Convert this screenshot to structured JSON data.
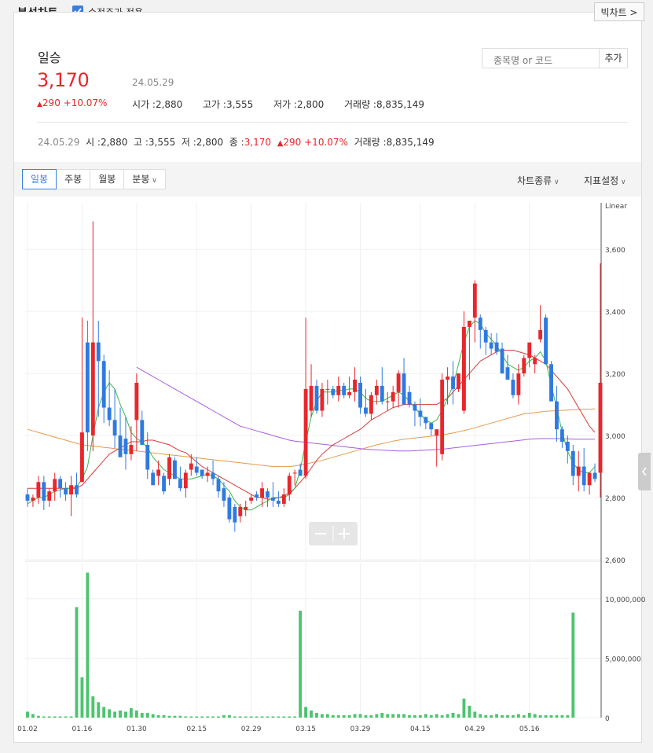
{
  "header": {
    "title": "분석차트",
    "adjusted_label": "수정주가 적용",
    "adjusted_checked": true,
    "big_chart_label": "빅차트 >"
  },
  "stock": {
    "name": "일승",
    "price": "3,170",
    "date": "24.05.29",
    "change": "290 +10.07%",
    "open_label": "시가 :",
    "open": "2,880",
    "high_label": "고가 :",
    "high": "3,555",
    "low_label": "저가 :",
    "low": "2,800",
    "volume_label": "거래량 :",
    "volume": "8,835,149"
  },
  "search": {
    "placeholder": "종목명 or 코드",
    "add_label": "추가"
  },
  "dayinfo": {
    "date": "24.05.29",
    "open_label": "시 :",
    "open": "2,880",
    "high_label": "고 :",
    "high": "3,555",
    "low_label": "저 :",
    "low": "2,800",
    "close_label": "종 :",
    "close": "3,170",
    "change": "290 +10.07%",
    "volume_label": "거래량 :",
    "volume": "8,835,149"
  },
  "toolbar": {
    "periods": [
      "일봉",
      "주봉",
      "월봉",
      "분봉"
    ],
    "active_period": "일봉",
    "chart_type_label": "차트종류",
    "indicator_label": "지표설정"
  },
  "colors": {
    "up": "#e8262c",
    "down": "#2f7ae0",
    "volume": "#4cc46e",
    "ma5": "#3bb84a",
    "ma20": "#d83a3a",
    "ma60": "#a85ee0",
    "ma120": "#e59a4a"
  },
  "chart_data": {
    "type": "candlestick",
    "scale": "Linear",
    "price_ylim": [
      2600,
      3750
    ],
    "price_ticks": [
      "3,600",
      "3,400",
      "3,200",
      "3,000",
      "2,800",
      "2,600"
    ],
    "volume_ticks": [
      "10,000,000",
      "5,000,000",
      "0"
    ],
    "volume_ylim": [
      0,
      12500000
    ],
    "x_tick_labels": [
      "01.02",
      "01.16",
      "01.30",
      "02.15",
      "02.29",
      "03.15",
      "03.29",
      "04.15",
      "04.29",
      "05.16"
    ],
    "x_tick_index": [
      0,
      10,
      20,
      31,
      41,
      51,
      61,
      72,
      82,
      92
    ],
    "ohlc": [
      [
        2810,
        2830,
        2770,
        2790
      ],
      [
        2790,
        2810,
        2770,
        2800
      ],
      [
        2800,
        2870,
        2780,
        2850
      ],
      [
        2850,
        2870,
        2760,
        2790
      ],
      [
        2790,
        2830,
        2770,
        2820
      ],
      [
        2820,
        2880,
        2790,
        2860
      ],
      [
        2860,
        2870,
        2800,
        2830
      ],
      [
        2830,
        2850,
        2790,
        2810
      ],
      [
        2810,
        2870,
        2740,
        2840
      ],
      [
        2840,
        2880,
        2800,
        2810
      ],
      [
        2850,
        3380,
        2850,
        3010
      ],
      [
        3300,
        3370,
        2950,
        3010
      ],
      [
        3000,
        3690,
        2950,
        3300
      ],
      [
        3300,
        3370,
        3060,
        3240
      ],
      [
        3240,
        3260,
        3040,
        3090
      ],
      [
        3090,
        3210,
        3030,
        3050
      ],
      [
        3050,
        3150,
        2960,
        3000
      ],
      [
        3000,
        3090,
        2940,
        2930
      ],
      [
        2990,
        3060,
        2890,
        2940
      ],
      [
        2940,
        3030,
        2920,
        2970
      ],
      [
        3050,
        3200,
        2950,
        3170
      ],
      [
        3050,
        3080,
        2970,
        2970
      ],
      [
        2970,
        3010,
        2860,
        2890
      ],
      [
        2880,
        2890,
        2840,
        2840
      ],
      [
        2870,
        2920,
        2840,
        2890
      ],
      [
        2870,
        2880,
        2810,
        2820
      ],
      [
        2860,
        2940,
        2840,
        2930
      ],
      [
        2920,
        2930,
        2860,
        2860
      ],
      [
        2860,
        2900,
        2820,
        2830
      ],
      [
        2830,
        2890,
        2800,
        2880
      ],
      [
        2890,
        2940,
        2870,
        2910
      ],
      [
        2900,
        2930,
        2870,
        2880
      ],
      [
        2890,
        2890,
        2860,
        2870
      ],
      [
        2870,
        2900,
        2850,
        2880
      ],
      [
        2880,
        2920,
        2840,
        2860
      ],
      [
        2860,
        2870,
        2800,
        2820
      ],
      [
        2830,
        2850,
        2770,
        2790
      ],
      [
        2800,
        2810,
        2720,
        2730
      ],
      [
        2770,
        2780,
        2690,
        2720
      ],
      [
        2740,
        2780,
        2720,
        2770
      ],
      [
        2760,
        2790,
        2740,
        2770
      ],
      [
        2790,
        2810,
        2780,
        2800
      ],
      [
        2810,
        2820,
        2790,
        2800
      ],
      [
        2800,
        2850,
        2770,
        2830
      ],
      [
        2820,
        2830,
        2770,
        2800
      ],
      [
        2800,
        2850,
        2770,
        2790
      ],
      [
        2790,
        2820,
        2770,
        2780
      ],
      [
        2780,
        2830,
        2770,
        2810
      ],
      [
        2810,
        2880,
        2790,
        2870
      ],
      [
        2880,
        2890,
        2840,
        2880
      ],
      [
        2890,
        2910,
        2880,
        2870
      ],
      [
        2870,
        3380,
        2860,
        3150
      ],
      [
        3080,
        3230,
        3060,
        3160
      ],
      [
        3160,
        3180,
        3070,
        3080
      ],
      [
        3080,
        3170,
        3060,
        3150
      ],
      [
        3150,
        3180,
        3100,
        3150
      ],
      [
        3150,
        3160,
        3120,
        3130
      ],
      [
        3130,
        3190,
        3110,
        3160
      ],
      [
        3160,
        3170,
        3120,
        3130
      ],
      [
        3130,
        3190,
        3120,
        3140
      ],
      [
        3140,
        3220,
        3110,
        3180
      ],
      [
        3170,
        3190,
        3070,
        3090
      ],
      [
        3090,
        3150,
        3060,
        3070
      ],
      [
        3070,
        3140,
        3050,
        3130
      ],
      [
        3130,
        3180,
        3100,
        3160
      ],
      [
        3160,
        3220,
        3100,
        3110
      ],
      [
        3110,
        3140,
        3080,
        3110
      ],
      [
        3110,
        3160,
        3090,
        3140
      ],
      [
        3140,
        3210,
        3090,
        3200
      ],
      [
        3200,
        3250,
        3110,
        3100
      ],
      [
        3140,
        3160,
        3090,
        3100
      ],
      [
        3100,
        3110,
        3030,
        3080
      ],
      [
        3080,
        3120,
        3030,
        3060
      ],
      [
        3060,
        3060,
        3020,
        3040
      ],
      [
        3040,
        3040,
        3000,
        3020
      ],
      [
        3000,
        3020,
        2900,
        3020
      ],
      [
        2940,
        3200,
        2920,
        3180
      ],
      [
        3180,
        3220,
        3100,
        3190
      ],
      [
        3190,
        3240,
        3100,
        3150
      ],
      [
        3150,
        3200,
        3140,
        3200
      ],
      [
        3080,
        3400,
        3070,
        3350
      ],
      [
        3350,
        3360,
        3180,
        3370
      ],
      [
        3380,
        3500,
        3300,
        3490
      ],
      [
        3380,
        3390,
        3280,
        3340
      ],
      [
        3340,
        3350,
        3260,
        3300
      ],
      [
        3300,
        3330,
        3260,
        3280
      ],
      [
        3300,
        3330,
        3260,
        3270
      ],
      [
        3280,
        3300,
        3200,
        3200
      ],
      [
        3220,
        3260,
        3180,
        3180
      ],
      [
        3180,
        3200,
        3120,
        3130
      ],
      [
        3130,
        3230,
        3100,
        3200
      ],
      [
        3200,
        3260,
        3190,
        3250
      ],
      [
        3250,
        3290,
        3220,
        3300
      ],
      [
        3230,
        3260,
        3200,
        3250
      ],
      [
        3310,
        3420,
        3300,
        3340
      ],
      [
        3380,
        3390,
        3240,
        3230
      ],
      [
        3230,
        3240,
        3160,
        3110
      ],
      [
        3110,
        3160,
        2980,
        3020
      ],
      [
        3020,
        3030,
        2960,
        2980
      ],
      [
        2980,
        3000,
        2910,
        2950
      ],
      [
        2950,
        2970,
        2840,
        2870
      ],
      [
        2870,
        2950,
        2820,
        2900
      ],
      [
        2900,
        2960,
        2820,
        2840
      ],
      [
        2840,
        2880,
        2810,
        2880
      ],
      [
        2880,
        2910,
        2850,
        2860
      ],
      [
        2880,
        3555,
        2800,
        3170
      ]
    ],
    "volume": [
      500000,
      300000,
      150000,
      100000,
      100000,
      100000,
      100000,
      100000,
      100000,
      9300000,
      3400000,
      12200000,
      1800000,
      1300000,
      900000,
      700000,
      500000,
      600000,
      500000,
      800000,
      600000,
      400000,
      400000,
      300000,
      200000,
      200000,
      150000,
      150000,
      150000,
      100000,
      100000,
      100000,
      100000,
      100000,
      100000,
      100000,
      200000,
      200000,
      100000,
      100000,
      100000,
      100000,
      100000,
      100000,
      100000,
      100000,
      100000,
      100000,
      100000,
      100000,
      9000000,
      900000,
      600000,
      400000,
      300000,
      300000,
      200000,
      200000,
      200000,
      200000,
      300000,
      300000,
      200000,
      200000,
      300000,
      400000,
      300000,
      300000,
      300000,
      300000,
      200000,
      200000,
      200000,
      300000,
      200000,
      300000,
      200000,
      300000,
      400000,
      300000,
      1600000,
      1000000,
      500000,
      300000,
      200000,
      200000,
      300000,
      200000,
      200000,
      200000,
      300000,
      200000,
      400000,
      300000,
      200000,
      200000,
      200000,
      200000,
      200000,
      200000,
      8835149
    ],
    "moving_averages": {
      "ma5": [
        2780,
        2790,
        2800,
        2800,
        2810,
        2820,
        2825,
        2830,
        2830,
        2835,
        2860,
        2900,
        3000,
        3090,
        3140,
        3170,
        3150,
        3100,
        3060,
        3010,
        2990,
        2980,
        2960,
        2930,
        2910,
        2890,
        2880,
        2870,
        2860,
        2860,
        2860,
        2865,
        2870,
        2875,
        2870,
        2860,
        2840,
        2820,
        2790,
        2770,
        2760,
        2760,
        2770,
        2780,
        2790,
        2800,
        2800,
        2800,
        2810,
        2830,
        2890,
        2980,
        3060,
        3110,
        3140,
        3140,
        3140,
        3145,
        3145,
        3150,
        3150,
        3140,
        3120,
        3110,
        3110,
        3110,
        3120,
        3130,
        3140,
        3130,
        3110,
        3090,
        3070,
        3050,
        3040,
        3050,
        3080,
        3120,
        3160,
        3230,
        3300,
        3350,
        3370,
        3360,
        3330,
        3310,
        3290,
        3260,
        3230,
        3220,
        3210,
        3220,
        3240,
        3250,
        3270,
        3240,
        3160,
        3090,
        3010,
        2950,
        2910,
        2890,
        2880,
        2880,
        2900
      ],
      "ma20": [
        2830,
        2830,
        2830,
        2830,
        2830,
        2830,
        2830,
        2830,
        2830,
        2830,
        2840,
        2860,
        2880,
        2900,
        2920,
        2940,
        2950,
        2960,
        2970,
        2980,
        2980,
        2980,
        2985,
        2985,
        2980,
        2975,
        2970,
        2960,
        2950,
        2945,
        2930,
        2915,
        2900,
        2890,
        2880,
        2870,
        2860,
        2850,
        2840,
        2830,
        2820,
        2810,
        2800,
        2800,
        2795,
        2795,
        2800,
        2805,
        2815,
        2830,
        2850,
        2870,
        2895,
        2920,
        2940,
        2955,
        2970,
        2980,
        2990,
        3000,
        3010,
        3020,
        3035,
        3050,
        3060,
        3070,
        3080,
        3090,
        3095,
        3100,
        3100,
        3100,
        3100,
        3100,
        3100,
        3100,
        3110,
        3120,
        3140,
        3160,
        3180,
        3200,
        3220,
        3240,
        3250,
        3260,
        3270,
        3275,
        3275,
        3275,
        3270,
        3265,
        3260,
        3250,
        3240,
        3230,
        3210,
        3190,
        3170,
        3150,
        3120,
        3090,
        3060,
        3030,
        3010
      ],
      "ma60": [
        null,
        null,
        null,
        null,
        null,
        null,
        null,
        null,
        null,
        null,
        null,
        null,
        null,
        null,
        null,
        null,
        null,
        null,
        null,
        null,
        3220,
        3210,
        3200,
        3190,
        3180,
        3170,
        3160,
        3150,
        3140,
        3130,
        3120,
        3110,
        3100,
        3090,
        3080,
        3070,
        3060,
        3050,
        3040,
        3030,
        3025,
        3020,
        3015,
        3010,
        3005,
        3000,
        2995,
        2990,
        2985,
        2982,
        2980,
        2978,
        2976,
        2974,
        2972,
        2970,
        2968,
        2966,
        2964,
        2962,
        2960,
        2958,
        2956,
        2955,
        2954,
        2953,
        2952,
        2951,
        2950,
        2950,
        2950,
        2951,
        2952,
        2953,
        2954,
        2955,
        2956,
        2958,
        2960,
        2962,
        2964,
        2966,
        2968,
        2970,
        2972,
        2974,
        2976,
        2978,
        2980,
        2982,
        2984,
        2986,
        2988,
        2989,
        2990,
        2990,
        2990,
        2990,
        2990,
        2989,
        2988,
        2988,
        2988,
        2988,
        2988
      ],
      "ma120": [
        3020,
        3015,
        3010,
        3005,
        3000,
        2995,
        2990,
        2985,
        2980,
        2975,
        2970,
        2968,
        2966,
        2964,
        2962,
        2960,
        2958,
        2956,
        2954,
        2952,
        2950,
        2948,
        2946,
        2944,
        2942,
        2940,
        2938,
        2936,
        2934,
        2932,
        2930,
        2928,
        2926,
        2924,
        2922,
        2920,
        2918,
        2916,
        2914,
        2912,
        2910,
        2908,
        2906,
        2904,
        2902,
        2900,
        2900,
        2900,
        2900,
        2902,
        2905,
        2908,
        2912,
        2916,
        2920,
        2925,
        2930,
        2935,
        2940,
        2945,
        2950,
        2955,
        2960,
        2965,
        2970,
        2974,
        2978,
        2982,
        2985,
        2988,
        2990,
        2992,
        2994,
        2996,
        2998,
        3000,
        3002,
        3005,
        3008,
        3012,
        3016,
        3020,
        3025,
        3030,
        3035,
        3040,
        3045,
        3050,
        3055,
        3060,
        3065,
        3070,
        3072,
        3074,
        3076,
        3078,
        3079,
        3080,
        3081,
        3082,
        3083,
        3084,
        3085,
        3085,
        3086
      ]
    }
  }
}
